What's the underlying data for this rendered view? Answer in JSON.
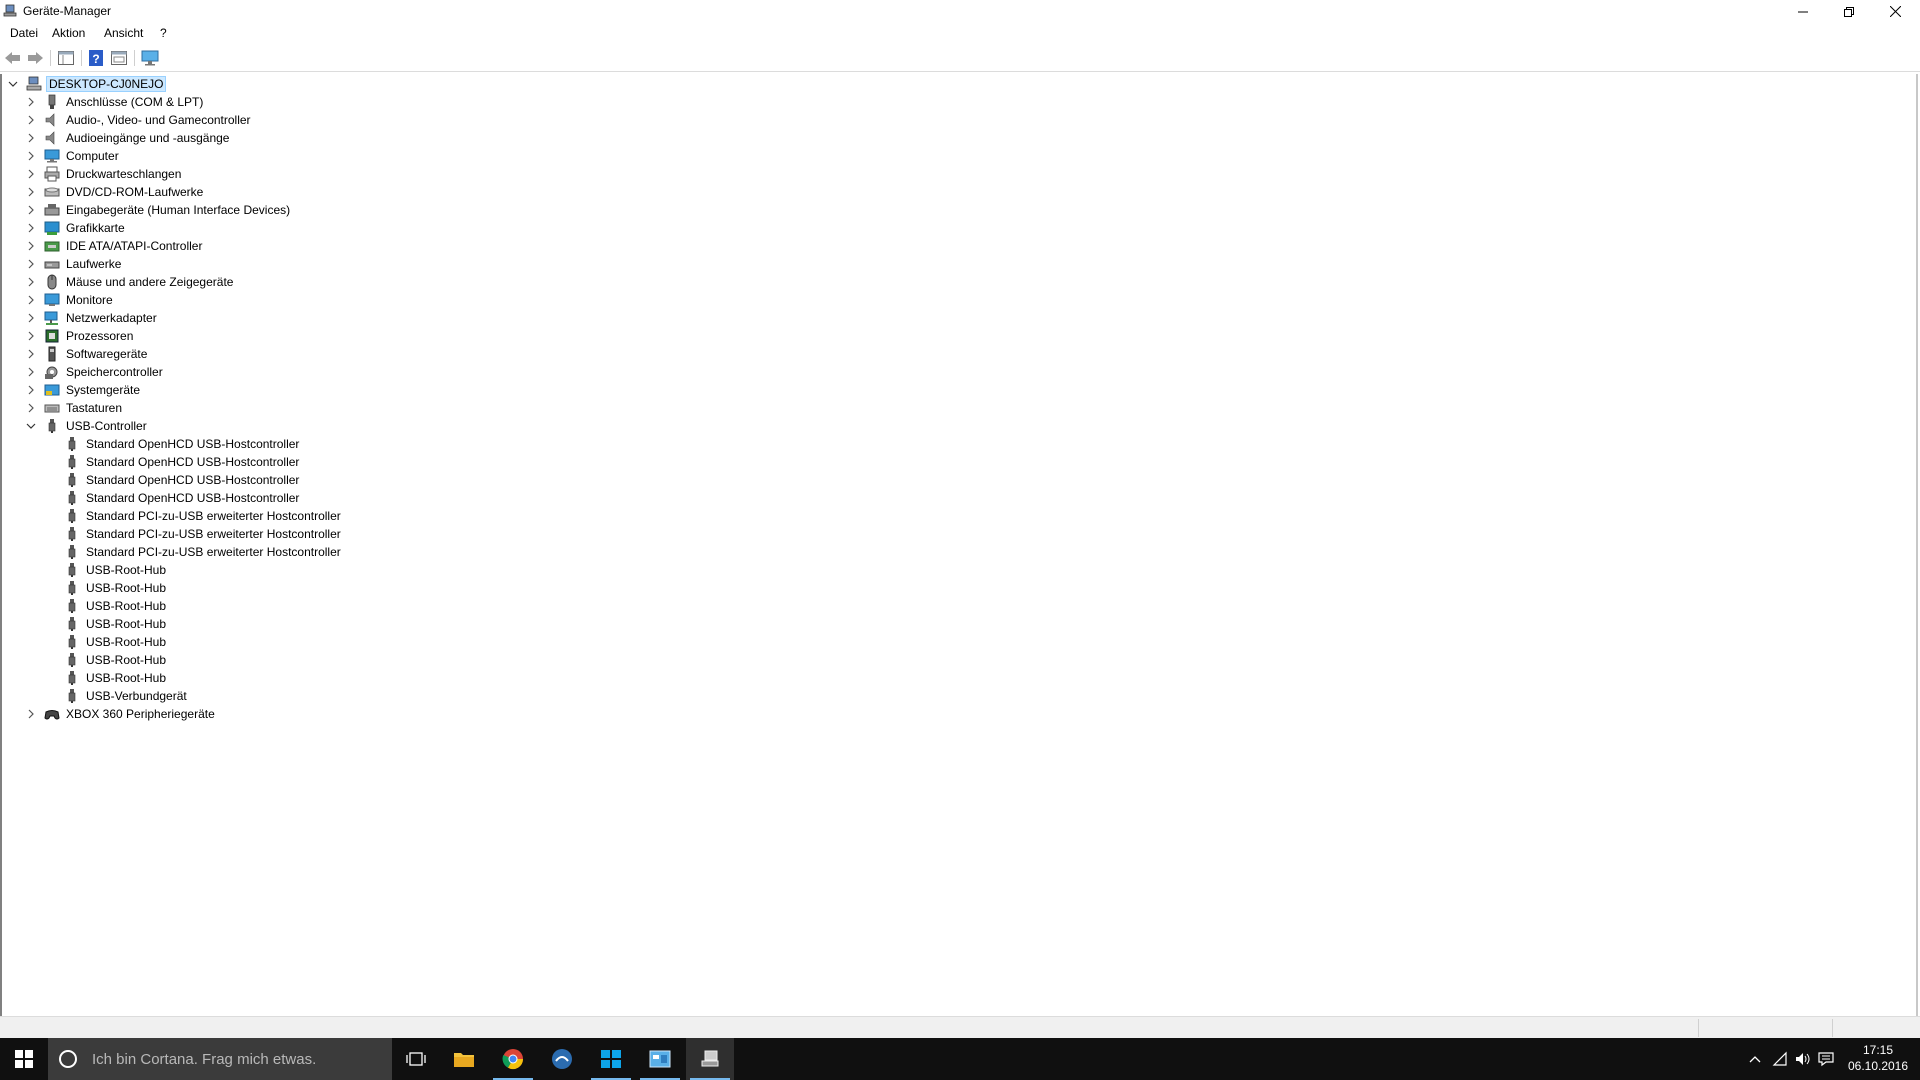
{
  "window": {
    "title": "Geräte-Manager"
  },
  "menu": {
    "items": [
      "Datei",
      "Aktion",
      "Ansicht",
      "?"
    ]
  },
  "tree": {
    "root": "DESKTOP-CJ0NEJO",
    "categories": [
      {
        "label": "Anschlüsse (COM & LPT)",
        "icon": "port-icon"
      },
      {
        "label": "Audio-, Video- und Gamecontroller",
        "icon": "speaker-icon"
      },
      {
        "label": "Audioeingänge und -ausgänge",
        "icon": "speaker-icon"
      },
      {
        "label": "Computer",
        "icon": "computer-icon"
      },
      {
        "label": "Druckwarteschlangen",
        "icon": "printer-icon"
      },
      {
        "label": "DVD/CD-ROM-Laufwerke",
        "icon": "dvd-drive-icon"
      },
      {
        "label": "Eingabegeräte (Human Interface Devices)",
        "icon": "hid-icon"
      },
      {
        "label": "Grafikkarte",
        "icon": "display-adapter-icon"
      },
      {
        "label": "IDE ATA/ATAPI-Controller",
        "icon": "ide-controller-icon"
      },
      {
        "label": "Laufwerke",
        "icon": "disk-drive-icon"
      },
      {
        "label": "Mäuse und andere Zeigegeräte",
        "icon": "mouse-icon"
      },
      {
        "label": "Monitore",
        "icon": "monitor-icon"
      },
      {
        "label": "Netzwerkadapter",
        "icon": "network-adapter-icon"
      },
      {
        "label": "Prozessoren",
        "icon": "processor-icon"
      },
      {
        "label": "Softwaregeräte",
        "icon": "software-device-icon"
      },
      {
        "label": "Speichercontroller",
        "icon": "storage-controller-icon"
      },
      {
        "label": "Systemgeräte",
        "icon": "system-device-icon"
      },
      {
        "label": "Tastaturen",
        "icon": "keyboard-icon"
      }
    ],
    "usb": {
      "label": "USB-Controller",
      "children": [
        "Standard OpenHCD USB-Hostcontroller",
        "Standard OpenHCD USB-Hostcontroller",
        "Standard OpenHCD USB-Hostcontroller",
        "Standard OpenHCD USB-Hostcontroller",
        "Standard PCI-zu-USB erweiterter Hostcontroller",
        "Standard PCI-zu-USB erweiterter Hostcontroller",
        "Standard PCI-zu-USB erweiterter Hostcontroller",
        "USB-Root-Hub",
        "USB-Root-Hub",
        "USB-Root-Hub",
        "USB-Root-Hub",
        "USB-Root-Hub",
        "USB-Root-Hub",
        "USB-Root-Hub",
        "USB-Verbundgerät"
      ]
    },
    "last": {
      "label": "XBOX 360 Peripheriegeräte",
      "icon": "gamepad-icon"
    }
  },
  "taskbar": {
    "search_placeholder": "Ich bin Cortana. Frag mich etwas.",
    "time": "17:15",
    "date": "06.10.2016"
  },
  "colors": {
    "selection": "#cce8ff",
    "taskbar": "#101010",
    "accent": "#76b9ed"
  }
}
